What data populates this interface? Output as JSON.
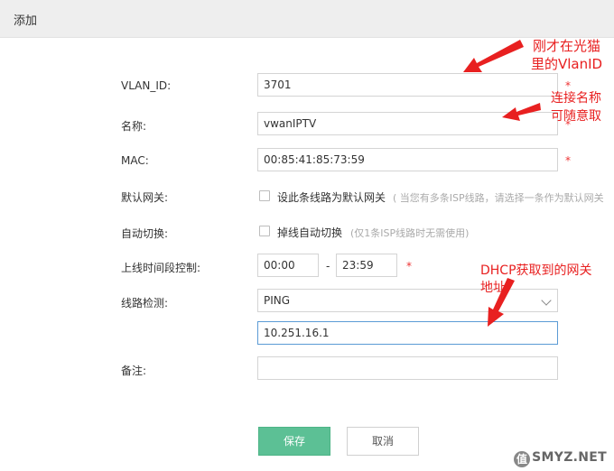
{
  "dialog": {
    "title": "添加"
  },
  "form": {
    "vlan_id": {
      "label": "VLAN_ID:",
      "value": "3701"
    },
    "name": {
      "label": "名称:",
      "value": "vwanIPTV"
    },
    "mac": {
      "label": "MAC:",
      "value": "00:85:41:85:73:59"
    },
    "default_gateway": {
      "label": "默认网关:",
      "checkbox_label": "设此条线路为默认网关",
      "hint": "( 当您有多条ISP线路，请选择一条作为默认网关"
    },
    "auto_switch": {
      "label": "自动切换:",
      "checkbox_label": "掉线自动切换",
      "hint": "(仅1条ISP线路时无需使用)"
    },
    "online_time": {
      "label": "上线时间段控制:",
      "start": "00:00",
      "separator": "-",
      "end": "23:59"
    },
    "line_detect": {
      "label": "线路检测:",
      "selected": "PING",
      "address": "10.251.16.1"
    },
    "remark": {
      "label": "备注:",
      "value": ""
    },
    "required_mark": "*"
  },
  "buttons": {
    "save": "保存",
    "cancel": "取消"
  },
  "annotations": {
    "vlan_note_1": "刚才在光猫",
    "vlan_note_2": "里的VlanID",
    "name_note_1": "连接名称",
    "name_note_2": "可随意取",
    "dhcp_note_1": "DHCP获取到的网关",
    "dhcp_note_2": "地址"
  },
  "watermark": {
    "logo": "值",
    "text": "SMYZ.NET"
  },
  "colors": {
    "annotation": "#e82020",
    "primary_button": "#5cc095",
    "required": "#e33333"
  }
}
